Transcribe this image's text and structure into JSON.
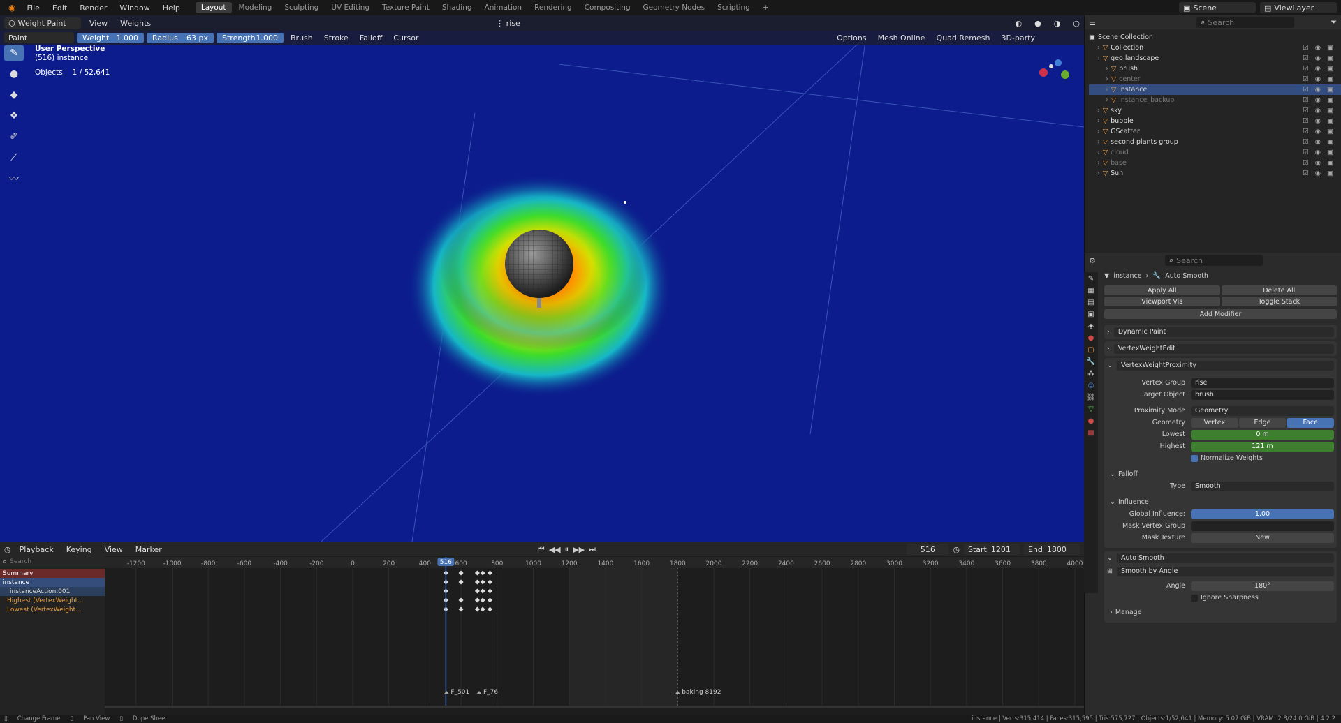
{
  "topbar": {
    "menus": [
      "File",
      "Edit",
      "Render",
      "Window",
      "Help"
    ],
    "workspaces": [
      "Layout",
      "Modeling",
      "Sculpting",
      "UV Editing",
      "Texture Paint",
      "Shading",
      "Animation",
      "Rendering",
      "Compositing",
      "Geometry Nodes",
      "Scripting"
    ],
    "active_workspace": "Layout",
    "scene": "Scene",
    "view_layer": "ViewLayer"
  },
  "viewport": {
    "mode": "Weight Paint",
    "menus": [
      "View",
      "Weights"
    ],
    "vertex_group_header": "rise",
    "tool_label": "Paint",
    "weight_label": "Weight",
    "weight_value": "1.000",
    "radius_label": "Radius",
    "radius_value": "63 px",
    "strength_label": "Strength",
    "strength_value": "1.000",
    "dropdowns": [
      "Brush",
      "Stroke",
      "Falloff",
      "Cursor"
    ],
    "options_label": "Options",
    "mesh_online": "Mesh Online",
    "quad_remesh": "Quad Remesh",
    "third_party": "3D-party",
    "info_title": "User Perspective",
    "info_object": "(516) instance",
    "objects_label": "Objects",
    "objects_value": "1 / 52,641"
  },
  "outliner": {
    "search_placeholder": "Search",
    "root": "Scene Collection",
    "items": [
      {
        "name": "Collection",
        "indent": 1,
        "state": "normal"
      },
      {
        "name": "geo landscape",
        "indent": 1,
        "state": "normal"
      },
      {
        "name": "brush",
        "indent": 2,
        "state": "normal"
      },
      {
        "name": "center",
        "indent": 2,
        "state": "dim"
      },
      {
        "name": "instance",
        "indent": 2,
        "state": "selected"
      },
      {
        "name": "instance_backup",
        "indent": 2,
        "state": "dim"
      },
      {
        "name": "sky",
        "indent": 1,
        "state": "normal"
      },
      {
        "name": "bubble",
        "indent": 1,
        "state": "normal"
      },
      {
        "name": "GScatter",
        "indent": 1,
        "state": "normal"
      },
      {
        "name": "second plants group",
        "indent": 1,
        "state": "normal"
      },
      {
        "name": "cloud",
        "indent": 1,
        "state": "dim"
      },
      {
        "name": "base",
        "indent": 1,
        "state": "dim"
      },
      {
        "name": "Sun",
        "indent": 1,
        "state": "normal"
      }
    ]
  },
  "properties": {
    "search_placeholder": "Search",
    "breadcrumb_object": "instance",
    "breadcrumb_modifier": "Auto Smooth",
    "apply_all": "Apply All",
    "delete_all": "Delete All",
    "viewport_vis": "Viewport Vis",
    "toggle_stack": "Toggle Stack",
    "add_modifier": "Add Modifier",
    "modifiers": [
      "Dynamic Paint",
      "VertexWeightEdit",
      "VertexWeightProximity"
    ],
    "vertex_group_label": "Vertex Group",
    "vertex_group_value": "rise",
    "target_object_label": "Target Object",
    "target_object_value": "brush",
    "proximity_mode_label": "Proximity Mode",
    "proximity_mode_value": "Geometry",
    "geometry_label": "Geometry",
    "geometry_options": [
      "Vertex",
      "Edge",
      "Face"
    ],
    "geometry_active": "Face",
    "lowest_label": "Lowest",
    "lowest_value": "0 m",
    "highest_label": "Highest",
    "highest_value": "121 m",
    "normalize_label": "Normalize Weights",
    "falloff_section": "Falloff",
    "type_label": "Type",
    "type_value": "Smooth",
    "influence_section": "Influence",
    "global_influence_label": "Global Influence:",
    "global_influence_value": "1.00",
    "mask_vertex_group_label": "Mask Vertex Group",
    "mask_texture_label": "Mask Texture",
    "new_label": "New",
    "auto_smooth_name": "Auto Smooth",
    "smooth_by_angle": "Smooth by Angle",
    "angle_label": "Angle",
    "angle_value": "180°",
    "ignore_sharpness": "Ignore Sharpness",
    "manage_section": "Manage"
  },
  "timeline": {
    "menus": [
      "Playback",
      "Keying",
      "View",
      "Marker"
    ],
    "current_frame": "516",
    "start_label": "Start",
    "start_value": "1201",
    "end_label": "End",
    "end_value": "1800",
    "ruler_ticks": [
      "-1200",
      "-1000",
      "-800",
      "-600",
      "-400",
      "-200",
      "0",
      "200",
      "400",
      "600",
      "800",
      "1000",
      "1200",
      "1400",
      "1600",
      "1800",
      "2000",
      "2200",
      "2400",
      "2600",
      "2800",
      "3000",
      "3200",
      "3400",
      "3600",
      "3800",
      "4000"
    ],
    "channels": [
      "Summary",
      "instance",
      "instanceAction.001",
      "Highest (VertexWeight...",
      "Lowest (VertexWeight..."
    ],
    "search_placeholder": "Search",
    "markers": [
      "F_501",
      "F_76",
      "baking 8192"
    ]
  },
  "statusbar": {
    "left": [
      "Change Frame",
      "Pan View",
      "Dope Sheet"
    ],
    "right": "instance | Verts:315,414 | Faces:315,595 | Tris:575,727 | Objects:1/52,641 | Memory: 5.07 GiB | VRAM: 2.8/24.0 GiB | 4.2.2"
  },
  "colors": {
    "accent": "#4772b3",
    "selection": "#334d80",
    "viewport_bg": "#0c1c8c",
    "green_field": "#3d7f2e"
  }
}
